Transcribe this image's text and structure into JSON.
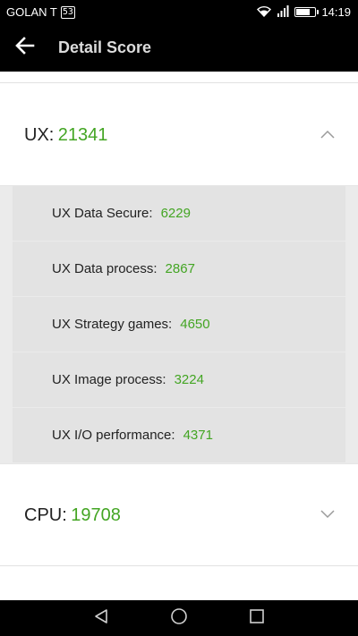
{
  "status_bar": {
    "carrier": "GOLAN T",
    "carrier_badge": "53",
    "time": "14:19",
    "battery_level": 0.75,
    "icons": [
      "wifi-icon",
      "signal-icon",
      "battery-icon"
    ]
  },
  "toolbar": {
    "title": "Detail Score",
    "back_icon": "arrow-left-icon"
  },
  "ux": {
    "label": "UX:",
    "score": "21341",
    "expanded": true,
    "items": [
      {
        "label": "UX Data Secure:",
        "value": "6229"
      },
      {
        "label": "UX Data process:",
        "value": "2867"
      },
      {
        "label": "UX Strategy games:",
        "value": "4650"
      },
      {
        "label": "UX Image process:",
        "value": "3224"
      },
      {
        "label": "UX I/O performance:",
        "value": "4371"
      }
    ]
  },
  "cpu": {
    "label": "CPU:",
    "score": "19708",
    "expanded": false
  },
  "nav_bar": {
    "icons": [
      "back-triangle-icon",
      "home-circle-icon",
      "recents-square-icon"
    ]
  },
  "colors": {
    "score_green": "#43a523",
    "toolbar_bg": "#000000",
    "panel_bg": "#ebebeb",
    "row_bg": "#e3e3e3"
  }
}
